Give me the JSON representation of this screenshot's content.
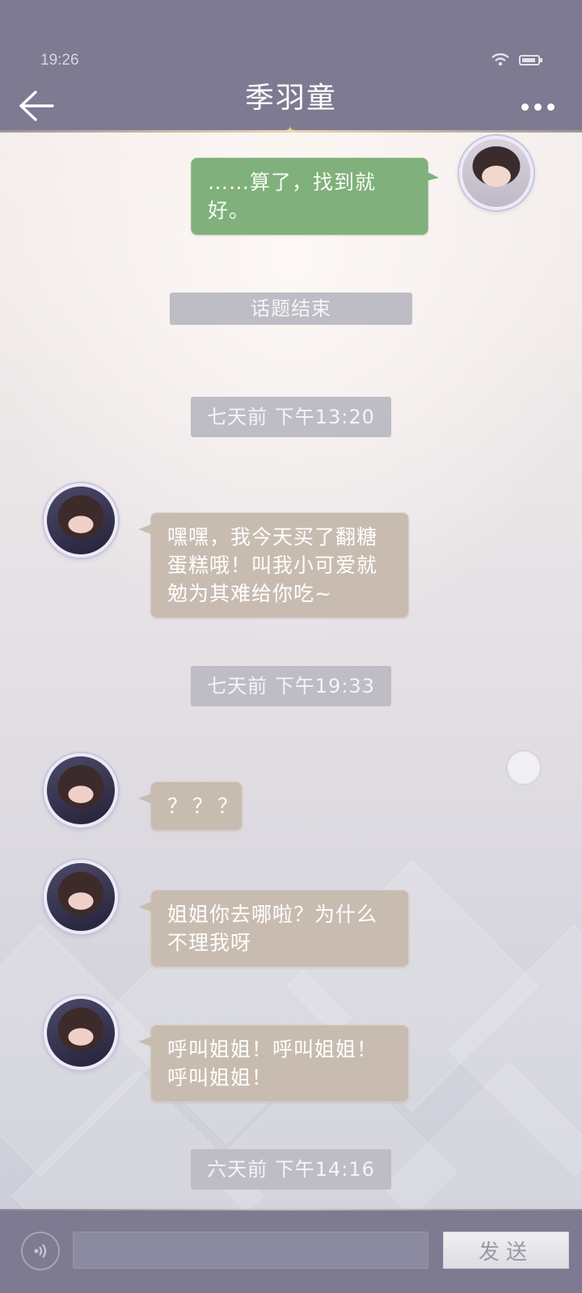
{
  "status_bar": {
    "time": "19:26",
    "icons": [
      "wifi-icon",
      "battery-icon"
    ]
  },
  "header": {
    "title": "季羽童",
    "back_icon": "back-arrow-icon",
    "more_icon": "more-icon"
  },
  "messages": [
    {
      "kind": "outgoing",
      "text": "……算了，找到就好。"
    },
    {
      "kind": "system",
      "text": "话题结束"
    },
    {
      "kind": "time",
      "text": "七天前 下午13:20"
    },
    {
      "kind": "incoming",
      "text": "嘿嘿，我今天买了翻糖蛋糕哦！叫我小可爱就勉为其难给你吃~"
    },
    {
      "kind": "time",
      "text": "七天前 下午19:33"
    },
    {
      "kind": "incoming",
      "text": "？？？"
    },
    {
      "kind": "incoming",
      "text": "姐姐你去哪啦？为什么不理我呀"
    },
    {
      "kind": "incoming",
      "text": "呼叫姐姐！呼叫姐姐！呼叫姐姐！"
    },
    {
      "kind": "time",
      "text": "六天前 下午14:16"
    }
  ],
  "composer": {
    "input_value": "",
    "send_label": "发送",
    "voice_icon": "voice-icon"
  },
  "colors": {
    "header_bg": "#7d7a91",
    "outgoing_bubble": "#80b07b",
    "incoming_bubble": "#c8bcb0",
    "time_pill": "#bebcc4"
  }
}
